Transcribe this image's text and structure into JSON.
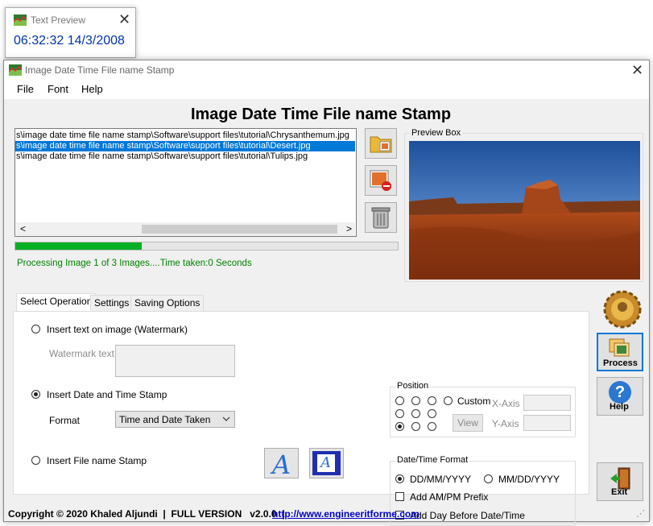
{
  "preview_window": {
    "title": "Text Preview",
    "preview_text": "06:32:32 14/3/2008"
  },
  "main_window": {
    "title": "Image Date Time File name Stamp"
  },
  "menu": {
    "file": "File",
    "font": "Font",
    "help": "Help"
  },
  "heading": "Image Date Time File name Stamp",
  "file_list": {
    "items": [
      "s\\image date time file name stamp\\Software\\support files\\tutorial\\Chrysanthemum.jpg",
      "s\\image date time file name stamp\\Software\\support files\\tutorial\\Desert.jpg",
      "s\\image date time file name stamp\\Software\\support files\\tutorial\\Tulips.jpg"
    ],
    "selected_index": 1,
    "scroll_left": "<",
    "scroll_right": ">"
  },
  "progress": {
    "value": 0.33
  },
  "status": "Processing Image 1 of 3 Images....Time taken:0 Seconds",
  "preview_box": {
    "label": "Preview Box"
  },
  "tabs": [
    "Select Operation",
    "Settings",
    "Saving Options"
  ],
  "operation": {
    "watermark_label": "Insert text on image (Watermark)",
    "watermark_text_label": "Watermark text",
    "datetime_label": "Insert Date and Time Stamp",
    "format_label": "Format",
    "format_value": "Time and Date Taken",
    "filename_label": "Insert File name Stamp",
    "selected": "datetime"
  },
  "position": {
    "label": "Position",
    "custom_label": "Custom",
    "x_axis": "X-Axis",
    "y_axis": "Y-Axis",
    "view": "View",
    "selected": "bottom-left"
  },
  "datetime_format": {
    "label": "Date/Time Format",
    "ddmm": "DD/MM/YYYY",
    "mmdd": "MM/DD/YYYY",
    "ampm": "Add AM/PM Prefix",
    "day": "Add Day Before Date/Time",
    "selected": "ddmm"
  },
  "side_buttons": {
    "process": "Process",
    "help": "Help",
    "exit": "Exit",
    "help_glyph": "?"
  },
  "font_buttons": {
    "letter": "A"
  },
  "footer": {
    "copyright": "Copyright © 2020 Khaled Aljundi  |  FULL VERSION   v2.0.0  |",
    "url": "http://www.engineeritforme.com"
  },
  "colors": {
    "accent": "#0078d7",
    "progress": "#06b025",
    "status": "#008000",
    "time_text": "#0033aa"
  }
}
